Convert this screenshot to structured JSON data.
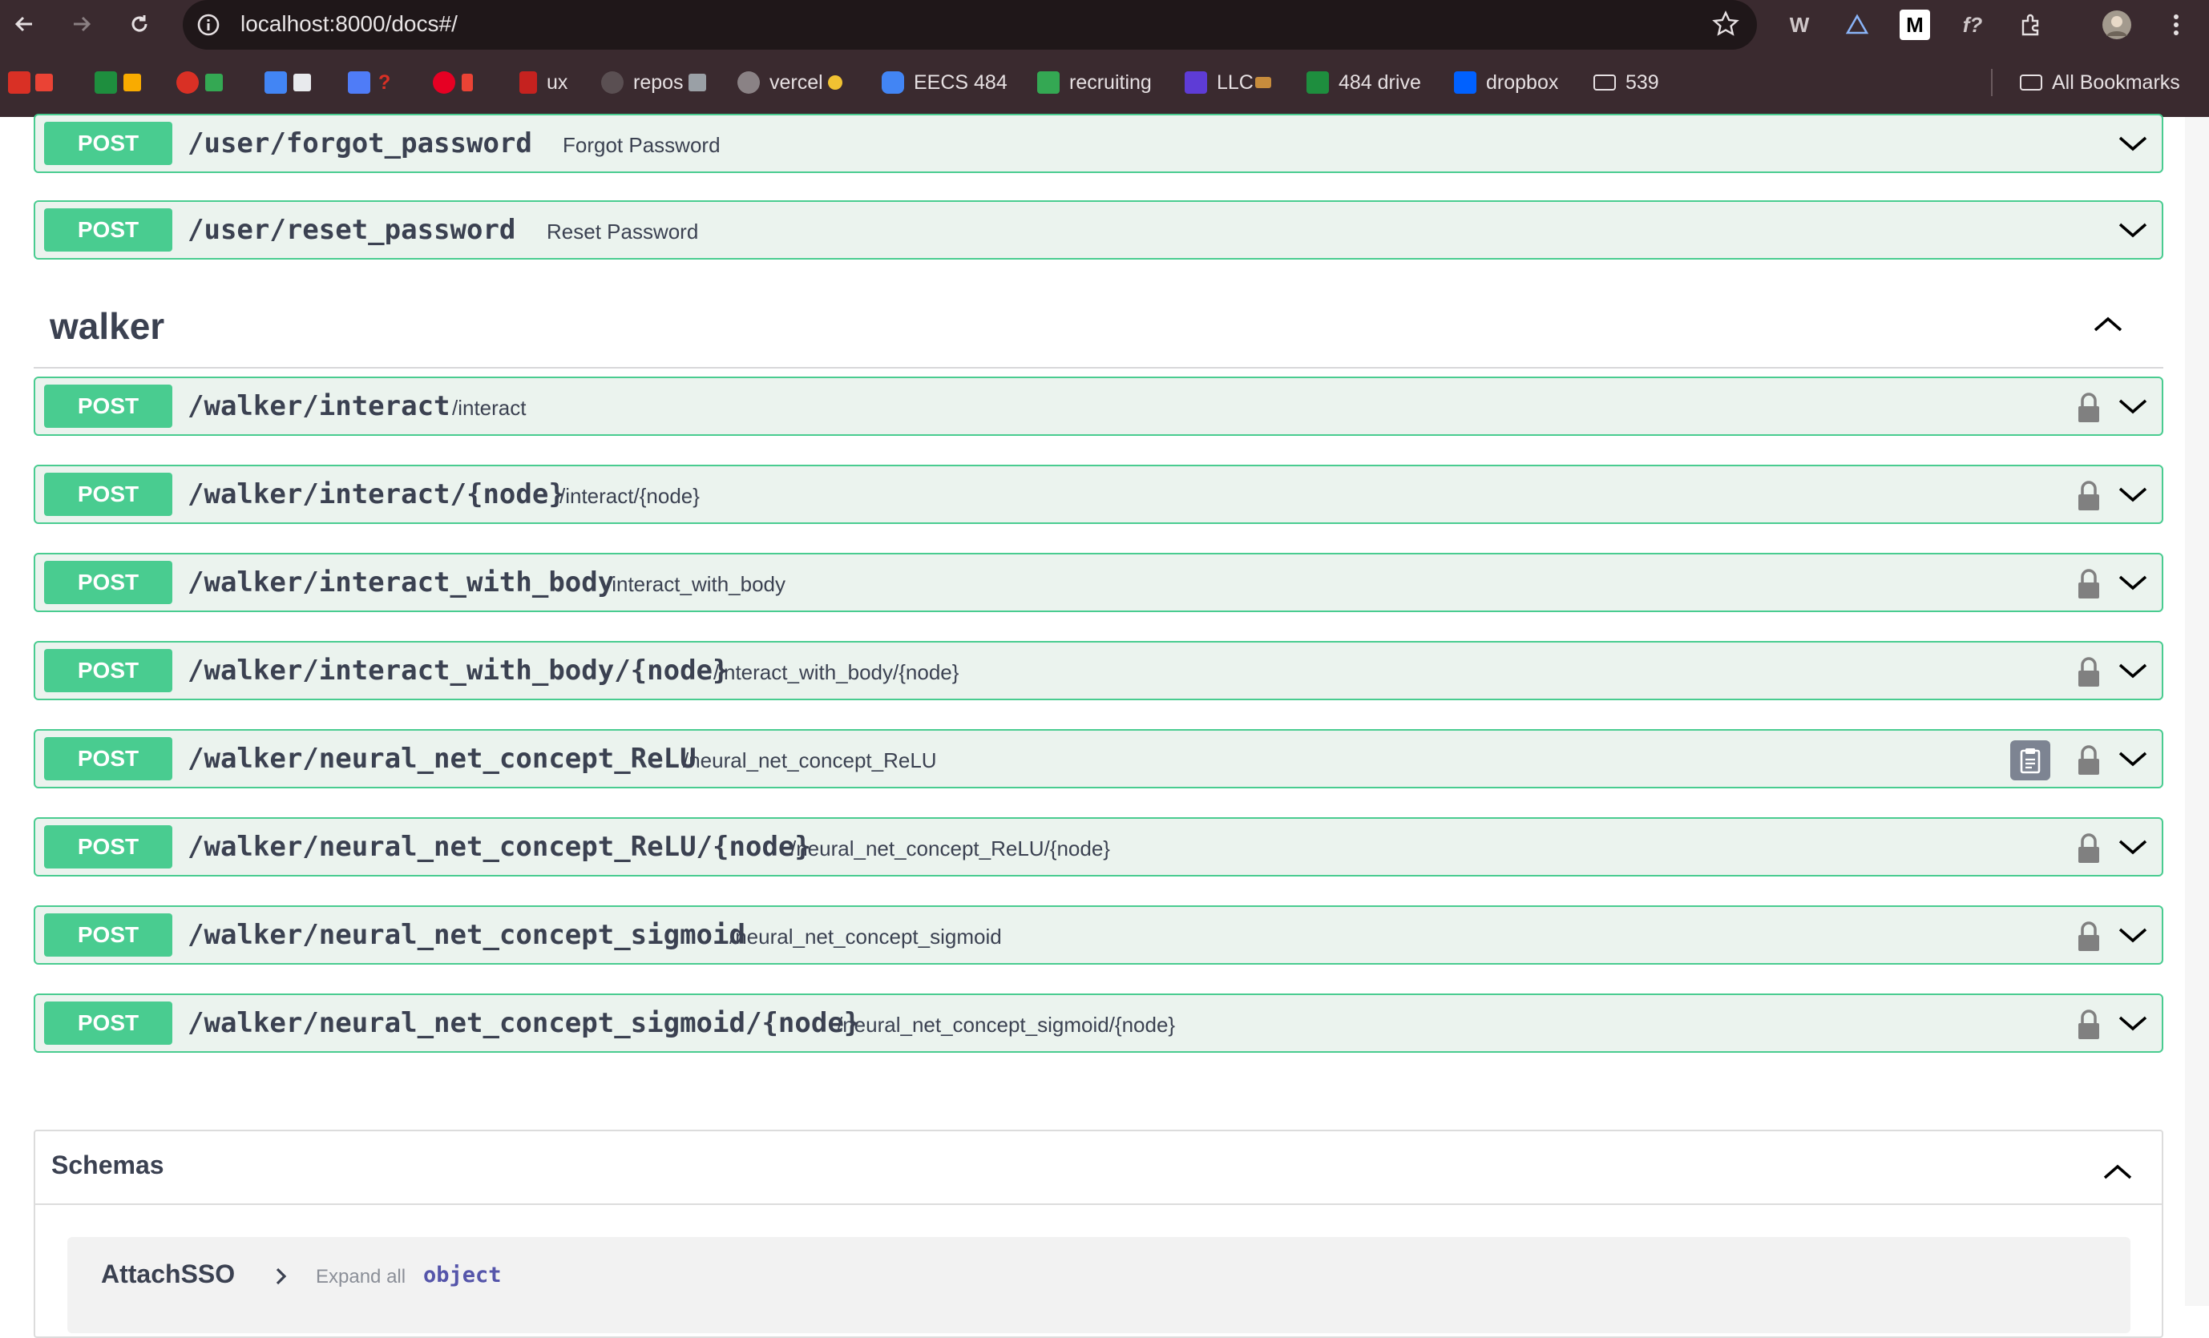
{
  "browser": {
    "url": "localhost:8000/docs#/",
    "bookmarks": [
      {
        "label": "",
        "color": "#d93025"
      },
      {
        "label": "",
        "color": "#1e8e3e"
      },
      {
        "label": "",
        "color": "#d93025"
      },
      {
        "label": "",
        "color": "#4285f4"
      },
      {
        "label": "",
        "color": "#4f7cf7"
      },
      {
        "label": "",
        "color": "#e60023"
      },
      {
        "label": "ux",
        "color": "#c5221f"
      },
      {
        "label": "repos",
        "color": "#cfc7c9"
      },
      {
        "label": "vercel",
        "color": "#cfc7c9"
      },
      {
        "label": "EECS 484",
        "color": "#4285f4"
      },
      {
        "label": "recruiting",
        "color": "#34a853"
      },
      {
        "label": "LLC",
        "color": "#5e3cd6"
      },
      {
        "label": "484 drive",
        "color": "#1e8e3e"
      },
      {
        "label": "dropbox",
        "color": "#0061ff"
      },
      {
        "label": "539",
        "color": "#cfc7c9"
      }
    ],
    "all_bookmarks_label": "All Bookmarks"
  },
  "user_ops": [
    {
      "method": "POST",
      "path": "/user/forgot_password",
      "summary": "Forgot Password"
    },
    {
      "method": "POST",
      "path": "/user/reset_password",
      "summary": "Reset Password"
    }
  ],
  "section": {
    "title": "walker"
  },
  "walker_ops": [
    {
      "method": "POST",
      "path": "/walker/interact",
      "summary": "/interact"
    },
    {
      "method": "POST",
      "path": "/walker/interact/{node}",
      "summary": "/interact/{node}"
    },
    {
      "method": "POST",
      "path": "/walker/interact_with_body",
      "summary": "/interact_with_body"
    },
    {
      "method": "POST",
      "path": "/walker/interact_with_body/{node}",
      "summary": "/interact_with_body/{node}"
    },
    {
      "method": "POST",
      "path": "/walker/neural_net_concept_ReLU",
      "summary": "/neural_net_concept_ReLU"
    },
    {
      "method": "POST",
      "path": "/walker/neural_net_concept_ReLU/{node}",
      "summary": "/neural_net_concept_ReLU/{node}"
    },
    {
      "method": "POST",
      "path": "/walker/neural_net_concept_sigmoid",
      "summary": "/neural_net_concept_sigmoid"
    },
    {
      "method": "POST",
      "path": "/walker/neural_net_concept_sigmoid/{node}",
      "summary": "/neural_net_concept_sigmoid/{node}"
    }
  ],
  "schemas": {
    "title": "Schemas",
    "model_name": "AttachSSO",
    "expand_all": "Expand all",
    "type": "object"
  },
  "colors": {
    "post_green": "#49cc90",
    "post_bg": "#ebf3ee",
    "text": "#3b4151"
  }
}
